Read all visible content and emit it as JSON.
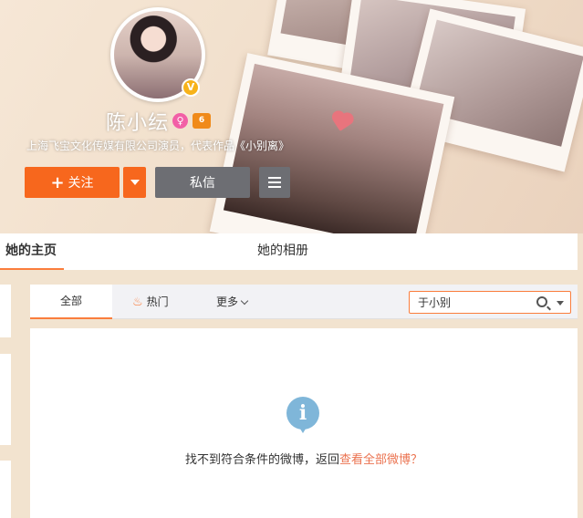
{
  "profile": {
    "name": "陈小纭",
    "verified_badge": "V",
    "gender_icon": "female-icon",
    "vip_label": "6",
    "description": "上海飞宝文化传媒有限公司演员，代表作品《小别离》"
  },
  "actions": {
    "follow_label": "关注",
    "message_label": "私信"
  },
  "tabs": [
    {
      "label": "她的主页"
    },
    {
      "label": "她的相册"
    }
  ],
  "feed_tabs": [
    {
      "label": "全部"
    },
    {
      "label": "热门"
    },
    {
      "label": "更多"
    }
  ],
  "search": {
    "value": "于小别"
  },
  "empty": {
    "message": "找不到符合条件的微博，返回",
    "link": "查看全部微博？"
  },
  "colors": {
    "accent": "#fa7d3c",
    "follow_button": "#f7671d",
    "secondary_button": "#6d6e73",
    "link": "#eb7350",
    "info_icon": "#7fb6d9"
  }
}
